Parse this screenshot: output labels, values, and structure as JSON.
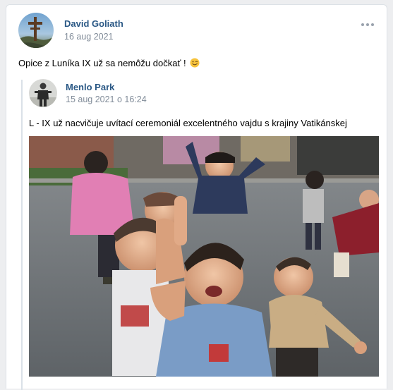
{
  "post": {
    "author": "David Goliath",
    "date": "16 aug 2021",
    "text": "Opice z Luníka IX už sa nemôžu dočkať !",
    "emoji": "winking-face-emoji"
  },
  "repost": {
    "author": "Menlo Park",
    "date": "15 aug 2021 o 16:24",
    "text": "L - IX už nacvičuje uvítací ceremoniál excelentného vajdu s krajiny Vatikánskej",
    "image": "photo of children in a street, one boy gesturing at the camera"
  },
  "colors": {
    "link": "#2a5885",
    "meta": "#818c99",
    "background": "#edeef0",
    "repost_bar": "#dae1e8"
  },
  "icons": {
    "more": "more-horizontal-icon"
  }
}
